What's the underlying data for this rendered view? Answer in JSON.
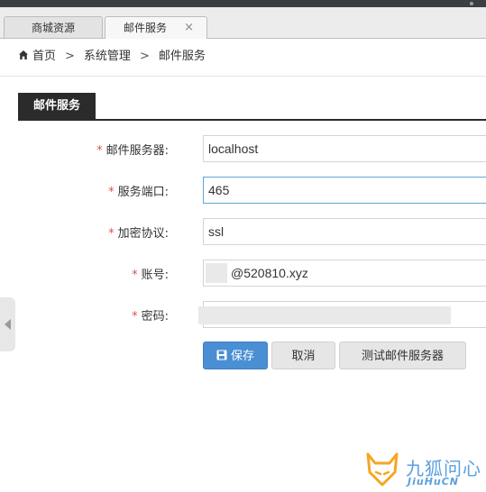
{
  "tabs": [
    {
      "label": "商城资源"
    },
    {
      "label": "邮件服务",
      "close": "×"
    }
  ],
  "breadcrumb": {
    "home": "首页",
    "sep": ">",
    "level2": "系统管理",
    "level3": "邮件服务"
  },
  "panel": {
    "title": "邮件服务"
  },
  "form": {
    "required_mark": "*",
    "server": {
      "label": "邮件服务器:",
      "value": "localhost"
    },
    "port": {
      "label": "服务端口:",
      "value": "465"
    },
    "encryption": {
      "label": "加密协议:",
      "value": "ssl"
    },
    "account": {
      "label": "账号:",
      "value": "@520810.xyz"
    },
    "password": {
      "label": "密码:",
      "value": ""
    }
  },
  "buttons": {
    "save": "保存",
    "cancel": "取消",
    "test": "测试邮件服务器"
  },
  "watermark": {
    "name": "九狐问心",
    "sub": "JiuHuCN"
  },
  "colors": {
    "accent": "#4a8fd4",
    "required": "#d9534f",
    "panel_tab": "#2b2b2b",
    "focus_border": "#5ea6d9",
    "watermark": "#5aa0dd",
    "watermark_logo": "#f5a623"
  }
}
